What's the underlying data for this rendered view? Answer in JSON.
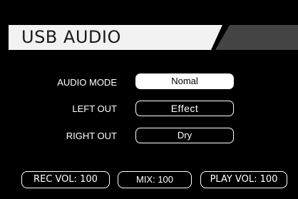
{
  "header": {
    "title": "USB AUDIO"
  },
  "rows": [
    {
      "label": "AUDIO MODE",
      "value": "Nomal",
      "selected": true
    },
    {
      "label": "LEFT OUT",
      "value": "Effect",
      "selected": false
    },
    {
      "label": "RIGHT OUT",
      "value": "Dry",
      "selected": false
    }
  ],
  "footer": {
    "rec_vol": "REC VOL: 100",
    "mix": "MIX: 100",
    "play_vol": "PLAY VOL: 100"
  },
  "colors": {
    "header_light": "#f2f2f2",
    "header_dark": "#444444",
    "background": "#000000"
  }
}
